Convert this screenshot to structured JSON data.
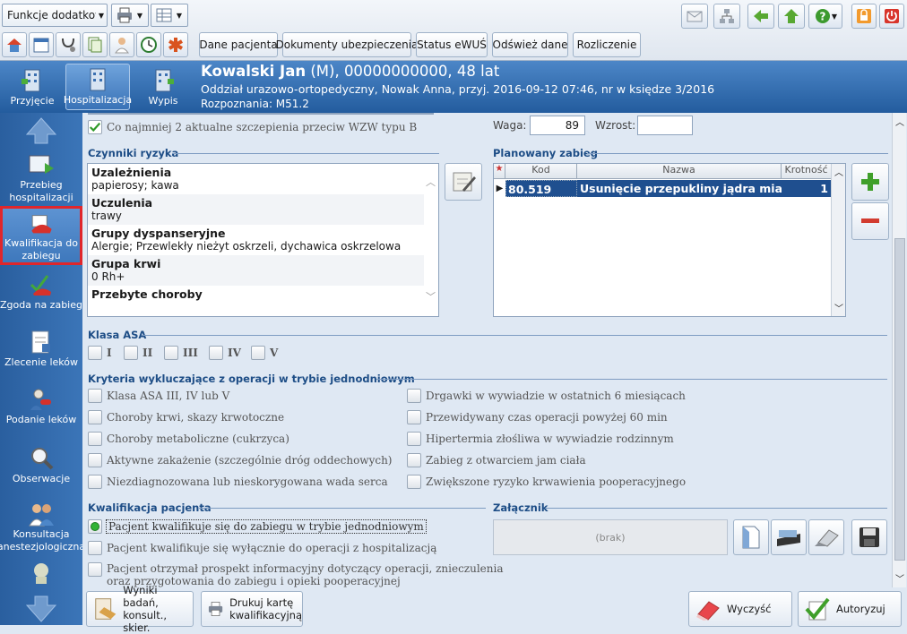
{
  "toolbar": {
    "functions_combo": "Funkcje dodatkowe",
    "buttons": [
      "Dane pacjenta",
      "Dokumenty ubezpieczenia",
      "Status eWUŚ",
      "Odśwież dane",
      "Rozliczenie"
    ]
  },
  "header": {
    "tabs": [
      "Przyjęcie",
      "Hospitalizacja",
      "Wypis"
    ],
    "patient_name": "Kowalski Jan",
    "patient_details": " (M), 00000000000, 48 lat",
    "department_line": "Oddział urazowo-ortopedyczny, Nowak Anna, przyj. 2016-09-12 07:46, nr w księdze 3/2016",
    "diagnosis": "Rozpoznania: M51.2"
  },
  "sidebar": {
    "items": [
      "Przebieg hospitalizacji",
      "Kwalifikacja do zabiegu",
      "Zgoda na zabieg",
      "Zlecenie leków",
      "Podanie leków",
      "Obserwacje",
      "Konsultacja anestezjologiczna"
    ]
  },
  "top": {
    "vaccine_check": "Co najmniej 2 aktualne szczepienia przeciw WZW typu B",
    "waga_label": "Waga:",
    "waga_value": "89",
    "wzrost_label": "Wzrost:",
    "wzrost_value": ""
  },
  "risk": {
    "title": "Czynniki ryzyka",
    "rows": [
      {
        "label": "Uzależnienia",
        "value": "papierosy; kawa"
      },
      {
        "label": "Uczulenia",
        "value": "trawy"
      },
      {
        "label": "Grupy dyspanseryjne",
        "value": "Alergie; Przewlekły nieżyt oskrzeli, dychawica oskrzelowa"
      },
      {
        "label": "Grupa krwi",
        "value": "0 Rh+"
      },
      {
        "label": "Przebyte choroby",
        "value": ""
      }
    ]
  },
  "planned": {
    "title": "Planowany zabieg",
    "columns": [
      "Kod",
      "Nazwa",
      "Krotność"
    ],
    "rows": [
      {
        "kod": "80.519",
        "nazwa": "Usunięcie przepukliny jądra miaż...",
        "krotnosc": "1"
      }
    ]
  },
  "asa": {
    "title": "Klasa ASA",
    "options": [
      "I",
      "II",
      "III",
      "IV",
      "V"
    ]
  },
  "criteria": {
    "title": "Kryteria wykluczające z operacji w trybie jednodniowym",
    "left": [
      "Klasa ASA III, IV lub V",
      "Choroby krwi, skazy krwotoczne",
      "Choroby metaboliczne (cukrzyca)",
      "Aktywne zakażenie (szczególnie dróg oddechowych)",
      "Niezdiagnozowana lub nieskorygowana wada serca"
    ],
    "right": [
      "Drgawki w wywiadzie w ostatnich 6 miesiącach",
      "Przewidywany czas operacji powyżej 60 min",
      "Hipertermia złośliwa w wywiadzie rodzinnym",
      "Zabieg z otwarciem jam ciała",
      "Zwiększone ryzyko krwawienia pooperacyjnego"
    ]
  },
  "qualification": {
    "title": "Kwalifikacja pacjenta",
    "options": [
      "Pacjent kwalifikuje się do zabiegu w trybie jednodniowym",
      "Pacjent kwalifikuje się wyłącznie do operacji z hospitalizacją"
    ],
    "prospekt_line1": "Pacjent otrzymał prospekt informacyjny dotyczący operacji, znieczulenia",
    "prospekt_line2": "oraz przygotowania do zabiegu i opieki pooperacyjnej"
  },
  "attachment": {
    "title": "Załącznik",
    "empty": "(brak)"
  },
  "bottom": {
    "wyniki_line1": "Wyniki badań,",
    "wyniki_line2": "konsult., skier.",
    "drukuj_line1": "Drukuj kartę",
    "drukuj_line2": "kwalifikacyjną",
    "wyczysc": "Wyczyść",
    "autoryzuj": "Autoryzuj"
  },
  "colors": {
    "header": "#2f6aae",
    "selection": "#1f4f8f",
    "highlight_border": "#e0262b",
    "plus": "#3f9f2a",
    "minus": "#d23b2f"
  }
}
